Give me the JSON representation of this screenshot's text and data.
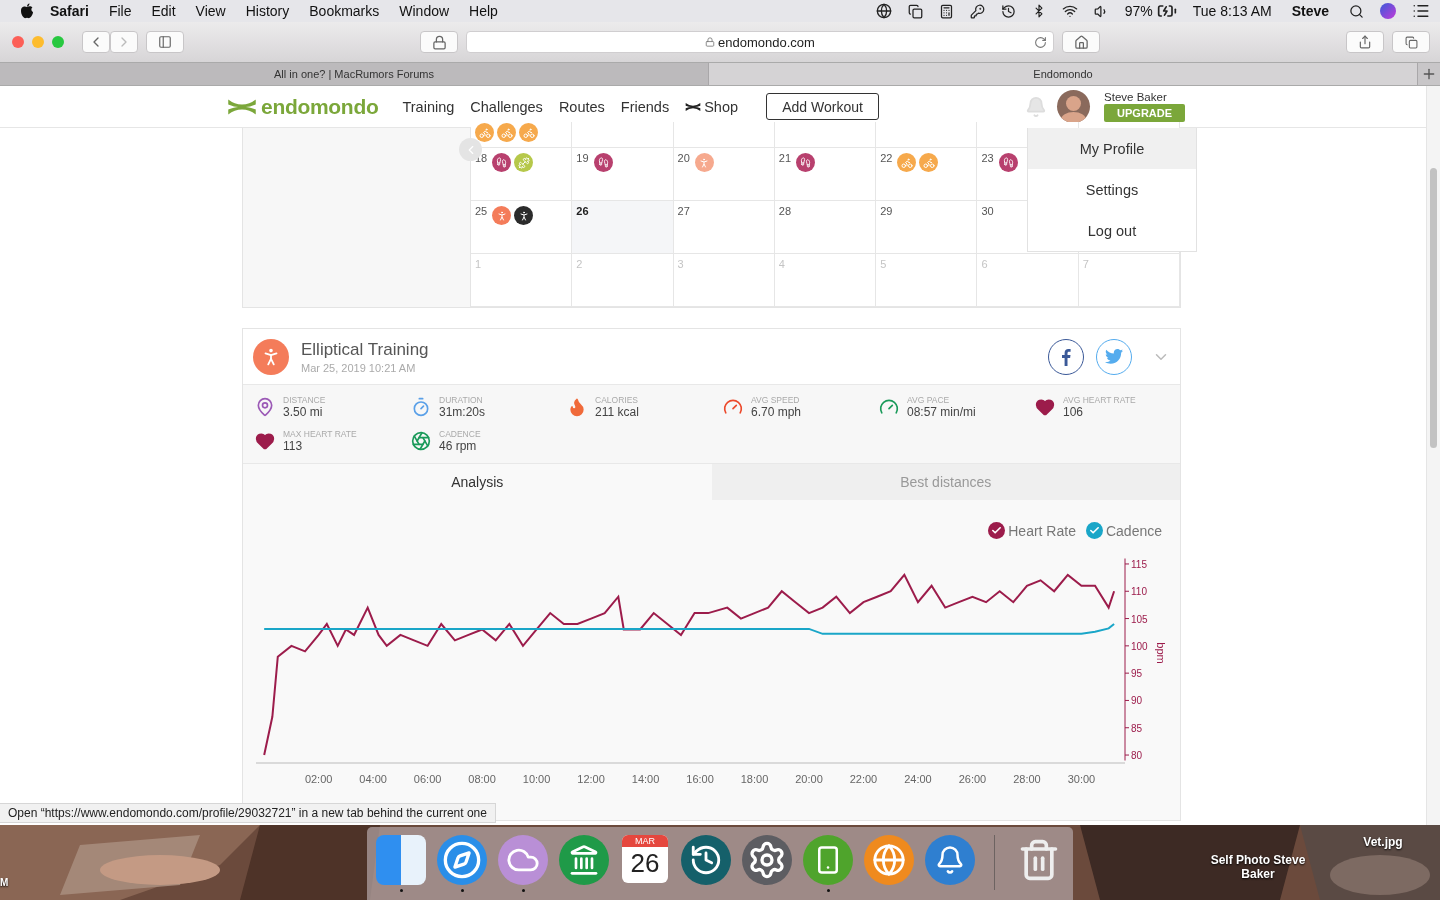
{
  "menubar": {
    "app": "Safari",
    "menus": [
      "File",
      "Edit",
      "View",
      "History",
      "Bookmarks",
      "Window",
      "Help"
    ],
    "battery": "97%",
    "clock": "Tue 8:13 AM",
    "user": "Steve"
  },
  "browser": {
    "address": "endomondo.com",
    "tabs": [
      {
        "title": "All in one? | MacRumors Forums",
        "selected": false
      },
      {
        "title": "Endomondo",
        "selected": true
      }
    ],
    "status": "Open “https://www.endomondo.com/profile/29032721” in a new tab behind the current one"
  },
  "header": {
    "logo": "endomondo",
    "nav": [
      {
        "label": "Training",
        "kind": "link"
      },
      {
        "label": "Challenges",
        "kind": "link"
      },
      {
        "label": "Routes",
        "kind": "link"
      },
      {
        "label": "Friends",
        "kind": "link"
      },
      {
        "label": "Shop",
        "kind": "shop"
      }
    ],
    "add_button": "Add Workout",
    "user": "Steve Baker",
    "upgrade": "UPGRADE"
  },
  "profile_menu": [
    {
      "label": "My Profile",
      "selected": true
    },
    {
      "label": "Settings",
      "selected": false
    },
    {
      "label": "Log out",
      "selected": false
    }
  ],
  "calendar": {
    "weeks": [
      {
        "days": [
          {
            "activities": [
              {
                "kind": "bike",
                "color": "#f6a94c"
              },
              {
                "kind": "bike",
                "color": "#f6a94c"
              },
              {
                "kind": "bike",
                "color": "#f6a94c"
              }
            ]
          }
        ]
      },
      {
        "days": [
          {
            "date": "18",
            "activities": [
              {
                "kind": "walk",
                "color": "#b8406e"
              },
              {
                "kind": "weights",
                "color": "#b6c84a"
              }
            ]
          },
          {
            "date": "19",
            "activities": [
              {
                "kind": "walk",
                "color": "#b8406e"
              }
            ]
          },
          {
            "date": "20",
            "activities": [
              {
                "kind": "yoga",
                "color": "#f6a98e"
              }
            ]
          },
          {
            "date": "21",
            "activities": [
              {
                "kind": "walk",
                "color": "#b8406e"
              }
            ]
          },
          {
            "date": "22",
            "activities": [
              {
                "kind": "bike",
                "color": "#f6a94c"
              },
              {
                "kind": "bike",
                "color": "#f6a94c"
              }
            ]
          },
          {
            "date": "23",
            "activities": [
              {
                "kind": "walk",
                "color": "#b8406e"
              }
            ]
          }
        ]
      },
      {
        "days": [
          {
            "date": "25",
            "activities": [
              {
                "kind": "elliptical",
                "color": "#f47c5a"
              },
              {
                "kind": "elliptical",
                "color": "#2b2b2b"
              }
            ]
          },
          {
            "date": "26",
            "today": true
          },
          {
            "date": "27",
            "today": false
          },
          {
            "date": "28",
            "today": false
          },
          {
            "date": "29",
            "today": false
          },
          {
            "date": "30",
            "today": false
          }
        ]
      },
      {
        "days": [
          {
            "date": "1",
            "other_month": true
          },
          {
            "date": "2",
            "other_month": true
          },
          {
            "date": "3",
            "other_month": true
          },
          {
            "date": "4",
            "other_month": true
          },
          {
            "date": "5",
            "other_month": true
          },
          {
            "date": "6",
            "other_month": true
          },
          {
            "date": "7",
            "other_month": true
          }
        ]
      }
    ]
  },
  "workout": {
    "title": "Elliptical Training",
    "date": "Mar 25, 2019 10:21 AM",
    "stats": [
      {
        "kind": "distance",
        "label": "DISTANCE",
        "value": "3.50 mi"
      },
      {
        "kind": "duration",
        "label": "DURATION",
        "value": "31m:20s"
      },
      {
        "kind": "calories",
        "label": "CALORIES",
        "value": "211 kcal"
      },
      {
        "kind": "speed",
        "label": "AVG SPEED",
        "value": "6.70 mph"
      },
      {
        "kind": "pace",
        "label": "AVG PACE",
        "value": "08:57 min/mi"
      },
      {
        "kind": "heart",
        "label": "AVG HEART RATE",
        "value": "106"
      },
      {
        "kind": "heart",
        "label": "MAX HEART RATE",
        "value": "113"
      },
      {
        "kind": "cadence",
        "label": "CADENCE",
        "value": "46 rpm"
      }
    ],
    "tabs": [
      {
        "label": "Analysis",
        "selected": true
      },
      {
        "label": "Best distances",
        "selected": false
      }
    ],
    "legend": [
      {
        "checked": true
      },
      {
        "checked": true
      }
    ],
    "chart_data": {
      "type": "line",
      "ylabel": "bpm",
      "x": [
        0,
        0.3,
        0.5,
        1,
        1.5,
        2,
        2.3,
        2.7,
        3,
        3.3,
        3.8,
        4.2,
        4.5,
        5,
        5.5,
        6,
        6.5,
        7,
        7.5,
        8,
        8.5,
        9,
        9.5,
        10,
        10.5,
        11,
        11.5,
        12,
        12.5,
        13,
        13.2,
        13.8,
        14.3,
        14.8,
        15.3,
        15.8,
        16.3,
        17,
        17.5,
        18,
        18.5,
        19,
        19.5,
        20,
        20.5,
        21,
        21.5,
        22,
        22.5,
        23,
        23.5,
        24,
        24.5,
        25,
        25.5,
        26,
        26.5,
        27,
        27.5,
        28,
        28.5,
        29,
        29.5,
        30,
        30.5,
        31,
        31.2
      ],
      "series": [
        {
          "name": "Heart Rate",
          "color": "#9c1c4b",
          "values": [
            80,
            87,
            98,
            100,
            99,
            102,
            104,
            100,
            103,
            102,
            107,
            102,
            100,
            102,
            101,
            100,
            104,
            101,
            102,
            103,
            101,
            104,
            100,
            103,
            106,
            104,
            104,
            105,
            106,
            109,
            103,
            103,
            106,
            104,
            102,
            106,
            106,
            107,
            105,
            106,
            107,
            110,
            108,
            106,
            107,
            109,
            106,
            108,
            109,
            110,
            113,
            108,
            111,
            107,
            108,
            109,
            108,
            110,
            108,
            111,
            112,
            110,
            113,
            111,
            111,
            107,
            110
          ]
        },
        {
          "name": "Cadence",
          "color": "#1aa6c8",
          "values": [
            103.1,
            103.1,
            103.1,
            103.1,
            103.1,
            103.1,
            103.1,
            103.1,
            103.1,
            103.1,
            103.1,
            103.1,
            103.1,
            103.1,
            103.1,
            103.1,
            103.1,
            103.1,
            103.1,
            103.1,
            103.1,
            103.1,
            103.1,
            103.1,
            103.1,
            103.1,
            103.1,
            103.1,
            103.1,
            103.1,
            103.1,
            103.1,
            103.1,
            103.1,
            103.1,
            103.1,
            103.1,
            103.1,
            103.1,
            103.1,
            103.1,
            103.1,
            103.1,
            103.1,
            102.2,
            102.2,
            102.2,
            102.2,
            102.2,
            102.2,
            102.2,
            102.2,
            102.2,
            102.2,
            102.2,
            102.2,
            102.2,
            102.2,
            102.2,
            102.2,
            102.2,
            102.2,
            102.2,
            102.2,
            102.6,
            103.2,
            104
          ]
        }
      ],
      "xlim": [
        -0.3,
        31.6
      ],
      "ylim": [
        79,
        116
      ],
      "xticks": [
        {
          "value": 2,
          "label": "02:00"
        },
        {
          "value": 4,
          "label": "04:00"
        },
        {
          "value": 6,
          "label": "06:00"
        },
        {
          "value": 8,
          "label": "08:00"
        },
        {
          "value": 10,
          "label": "10:00"
        },
        {
          "value": 12,
          "label": "12:00"
        },
        {
          "value": 14,
          "label": "14:00"
        },
        {
          "value": 16,
          "label": "16:00"
        },
        {
          "value": 18,
          "label": "18:00"
        },
        {
          "value": 20,
          "label": "20:00"
        },
        {
          "value": 22,
          "label": "22:00"
        },
        {
          "value": 24,
          "label": "24:00"
        },
        {
          "value": 26,
          "label": "26:00"
        },
        {
          "value": 28,
          "label": "28:00"
        },
        {
          "value": 30,
          "label": "30:00"
        }
      ],
      "yticks": [
        80,
        85,
        90,
        95,
        100,
        105,
        110,
        115
      ]
    }
  },
  "desktop": {
    "files": [
      "Self Photo Steve Baker",
      "Vet.jpg"
    ],
    "edge_label": "M",
    "dock": [
      {
        "kind": "finder",
        "running": true
      },
      {
        "kind": "safari",
        "running": true
      },
      {
        "kind": "e-app",
        "running": true
      },
      {
        "kind": "bank",
        "running": false
      },
      {
        "kind": "calendar",
        "month": "MAR",
        "day": "26",
        "running": false
      },
      {
        "kind": "time-machine",
        "running": false
      },
      {
        "kind": "settings",
        "running": false
      },
      {
        "kind": "phone-app",
        "running": true
      },
      {
        "kind": "globe",
        "running": false
      },
      {
        "kind": "bell",
        "running": false
      },
      {
        "kind": "divider"
      },
      {
        "kind": "trash",
        "running": false
      }
    ]
  }
}
